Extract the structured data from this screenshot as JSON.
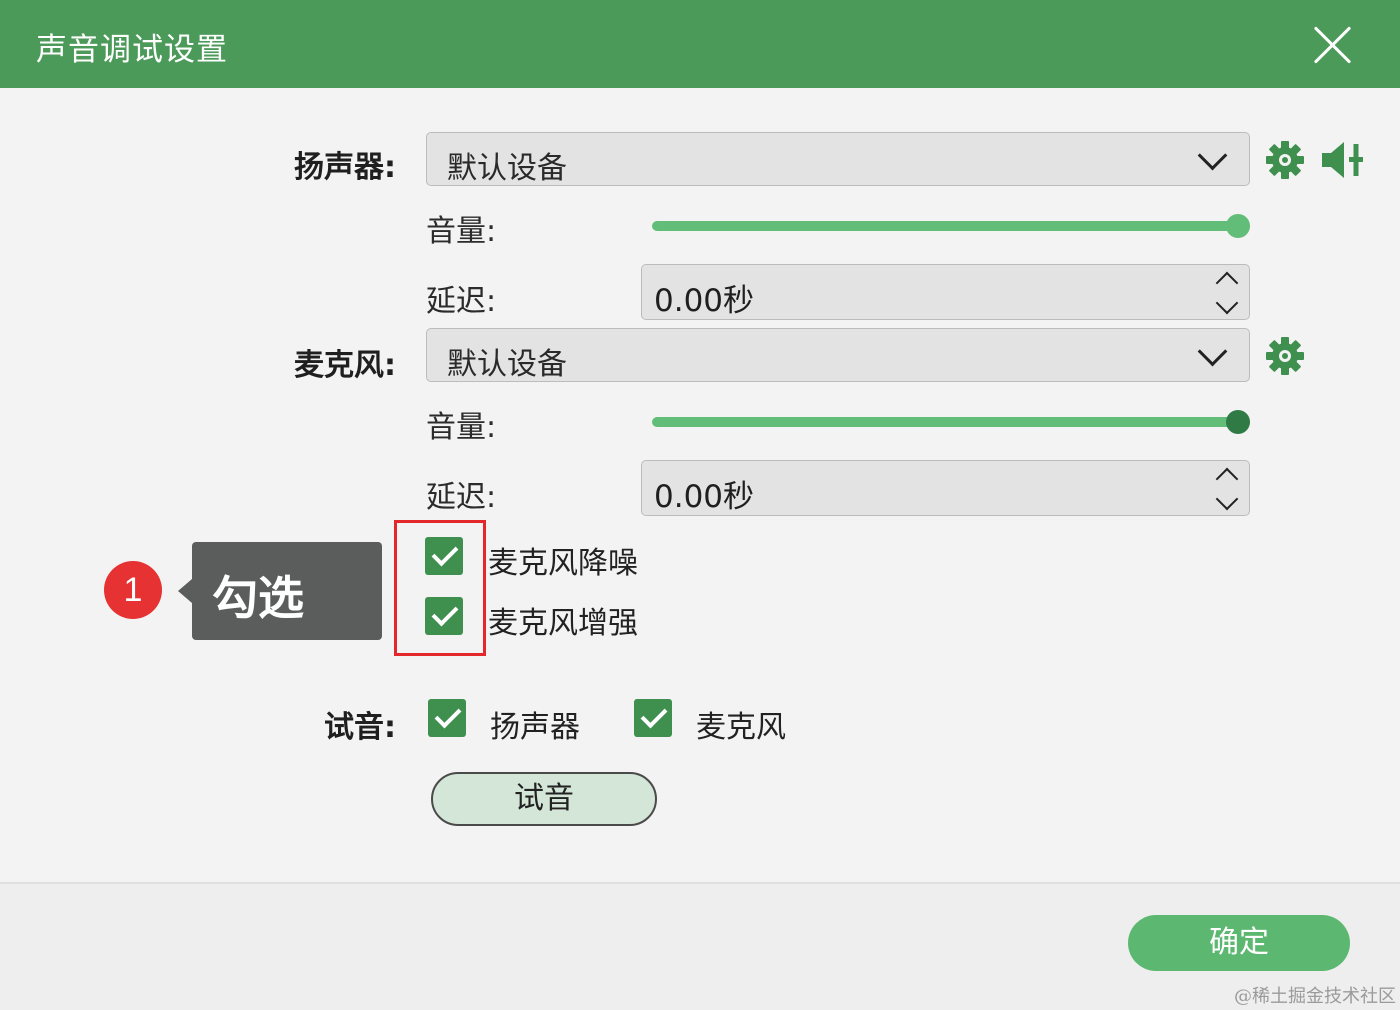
{
  "window": {
    "title": "声音调试设置"
  },
  "speaker": {
    "label": "扬声器:",
    "device": "默认设备",
    "volume_label": "音量:",
    "volume_fraction": 1.0,
    "delay_label": "延迟:",
    "delay_value": "0.00秒"
  },
  "microphone": {
    "label": "麦克风:",
    "device": "默认设备",
    "volume_label": "音量:",
    "volume_fraction": 1.0,
    "delay_label": "延迟:",
    "delay_value": "0.00秒",
    "noise_reduction_label": "麦克风降噪",
    "noise_reduction_checked": true,
    "enhance_label": "麦克风增强",
    "enhance_checked": true
  },
  "test": {
    "label": "试音:",
    "speaker_label": "扬声器",
    "speaker_checked": true,
    "mic_label": "麦克风",
    "mic_checked": true,
    "button_label": "试音"
  },
  "annotation": {
    "step_number": "1",
    "callout_text": "勾选"
  },
  "footer": {
    "ok_label": "确定",
    "watermark": "@稀土掘金技术社区"
  },
  "colors": {
    "title_bar": "#4c9a5a",
    "accent_green": "#3f8f4f",
    "slider_track": "#62bd78",
    "speaker_thumb": "#62bd78",
    "mic_thumb": "#2f7a45",
    "highlight_red": "#e3272b",
    "ok_button": "#5cb870"
  },
  "icons": {
    "close": "close-icon",
    "dropdown": "chevron-down-icon",
    "settings": "gear-icon",
    "speaker_test": "speaker-volume-icon",
    "check": "checkmark-icon"
  }
}
